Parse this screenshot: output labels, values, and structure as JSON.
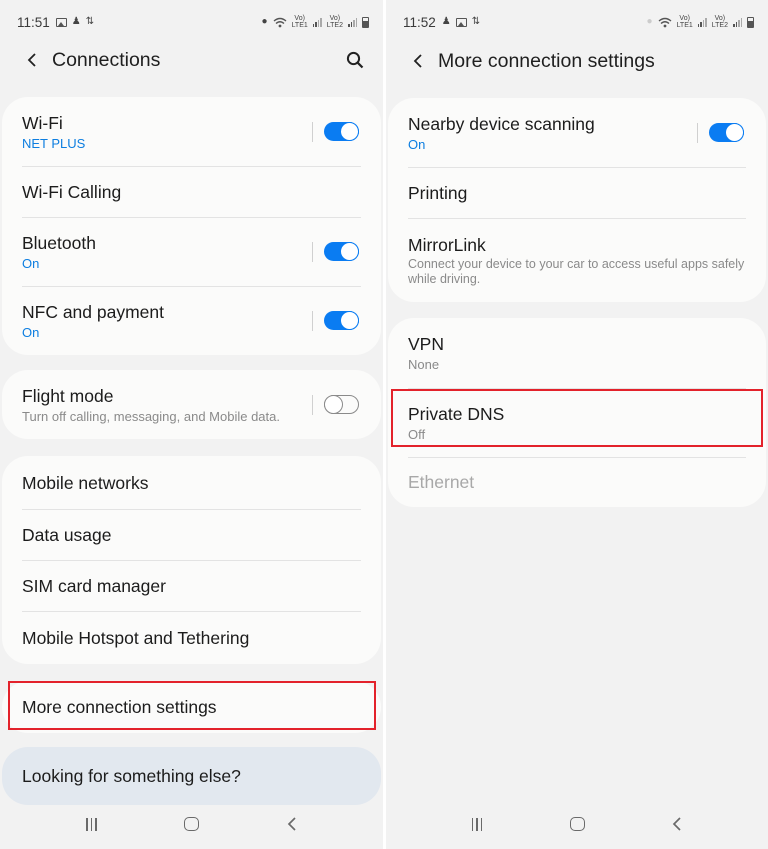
{
  "colors": {
    "accent": "#0a7cf2",
    "background": "#f2f2f2",
    "card": "#fbfbfa",
    "highlight": "#e3222b",
    "suggest_card": "#e2e8ef"
  },
  "left": {
    "status_bar": {
      "time": "11:51",
      "left_icons": [
        "gallery-icon",
        "notification-icon",
        "data-transfer-icon"
      ],
      "right_icons": [
        "location-icon",
        "wifi-icon",
        "volte-lte1-signal-icon",
        "volte-lte2-signal-icon",
        "battery-icon"
      ],
      "sim1_label": "VoLTE LTE1",
      "sim2_label": "VoLTE LTE2"
    },
    "app_bar": {
      "title": "Connections",
      "back_icon": "chevron-left-icon",
      "search_icon": "search-icon"
    },
    "groups": [
      {
        "items": [
          {
            "title": "Wi-Fi",
            "subtitle": "NET PLUS",
            "toggle": true
          },
          {
            "title": "Wi-Fi Calling"
          },
          {
            "title": "Bluetooth",
            "subtitle": "On",
            "toggle": true
          },
          {
            "title": "NFC and payment",
            "subtitle": "On",
            "toggle": true
          }
        ]
      },
      {
        "items": [
          {
            "title": "Flight mode",
            "subtitle": "Turn off calling, messaging, and Mobile data.",
            "toggle": false
          }
        ]
      },
      {
        "items": [
          {
            "title": "Mobile networks"
          },
          {
            "title": "Data usage"
          },
          {
            "title": "SIM card manager"
          },
          {
            "title": "Mobile Hotspot and Tethering"
          }
        ]
      },
      {
        "items": [
          {
            "title": "More connection settings",
            "highlighted": true
          }
        ]
      }
    ],
    "suggestion": "Looking for something else?"
  },
  "right": {
    "status_bar": {
      "time": "11:52",
      "left_icons": [
        "notification-icon",
        "gallery-icon",
        "data-transfer-icon"
      ],
      "right_icons": [
        "location-icon",
        "wifi-icon",
        "volte-lte1-signal-icon",
        "volte-lte2-signal-icon",
        "battery-icon"
      ],
      "sim1_label": "VoLTE LTE1",
      "sim2_label": "VoLTE LTE2"
    },
    "app_bar": {
      "title": "More connection settings",
      "back_icon": "chevron-left-icon"
    },
    "groups": [
      {
        "items": [
          {
            "title": "Nearby device scanning",
            "subtitle": "On",
            "toggle": true
          },
          {
            "title": "Printing"
          },
          {
            "title": "MirrorLink",
            "subtitle": "Connect your device to your car to access useful apps safely while driving."
          }
        ]
      },
      {
        "items": [
          {
            "title": "VPN",
            "subtitle": "None"
          },
          {
            "title": "Private DNS",
            "subtitle": "Off",
            "highlighted": true
          },
          {
            "title": "Ethernet",
            "disabled": true
          }
        ]
      }
    ]
  },
  "nav_bar": {
    "recent_icon": "recent-apps-icon",
    "home_icon": "home-icon",
    "back_icon": "back-icon"
  }
}
